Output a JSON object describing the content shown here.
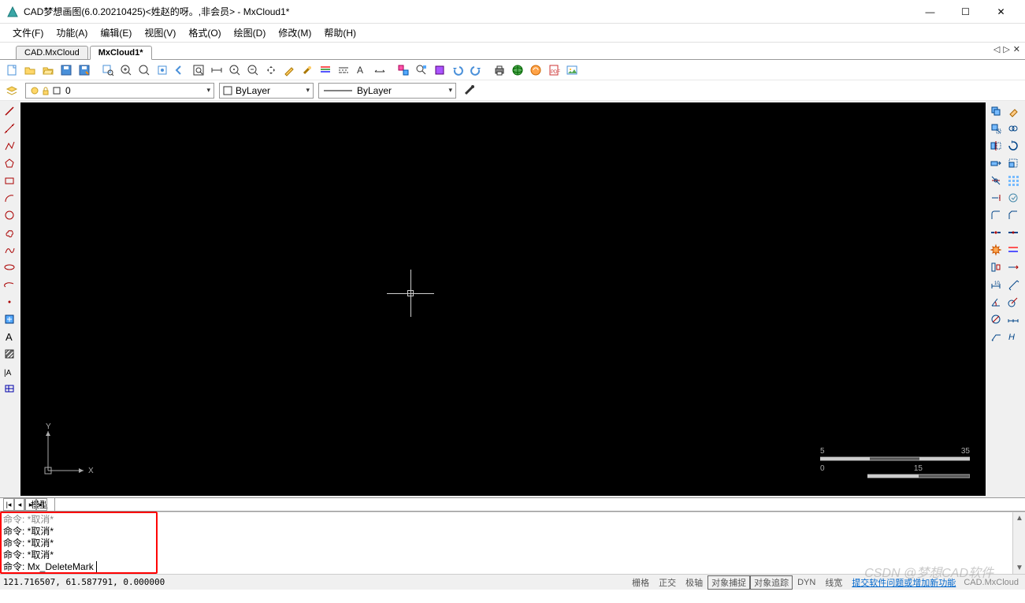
{
  "title": "CAD梦想画图(6.0.20210425)<姓赵的呀。,非会员> - MxCloud1*",
  "menus": [
    "文件(F)",
    "功能(A)",
    "编辑(E)",
    "视图(V)",
    "格式(O)",
    "绘图(D)",
    "修改(M)",
    "帮助(H)"
  ],
  "doc_tabs": {
    "items": [
      "CAD.MxCloud",
      "MxCloud1*"
    ],
    "active": 1
  },
  "layer": {
    "current": "0",
    "color_by": "ByLayer",
    "linetype": "ByLayer"
  },
  "model_tab": "模型",
  "cmd_history": [
    "命令:  *取消*",
    "命令:  *取消*",
    "命令:  *取消*",
    "命令:  *取消*"
  ],
  "cmd_prompt_label": "命令:",
  "cmd_input": "Mx_DeleteMark",
  "status": {
    "coords": "121.716507,  61.587791,  0.000000",
    "items": [
      "栅格",
      "正交",
      "极轴",
      "对象捕捉",
      "对象追踪",
      "DYN",
      "线宽"
    ],
    "boxed": [
      "对象捕捉",
      "对象追踪"
    ],
    "link": "提交软件问题或增加新功能",
    "brand": "CAD.MxCloud"
  },
  "scale": {
    "top_left": "5",
    "top_right": "35",
    "bot_left": "0",
    "bot_right": "15"
  },
  "ucs": {
    "x": "X",
    "y": "Y"
  },
  "watermark": "CSDN @梦想CAD软件"
}
